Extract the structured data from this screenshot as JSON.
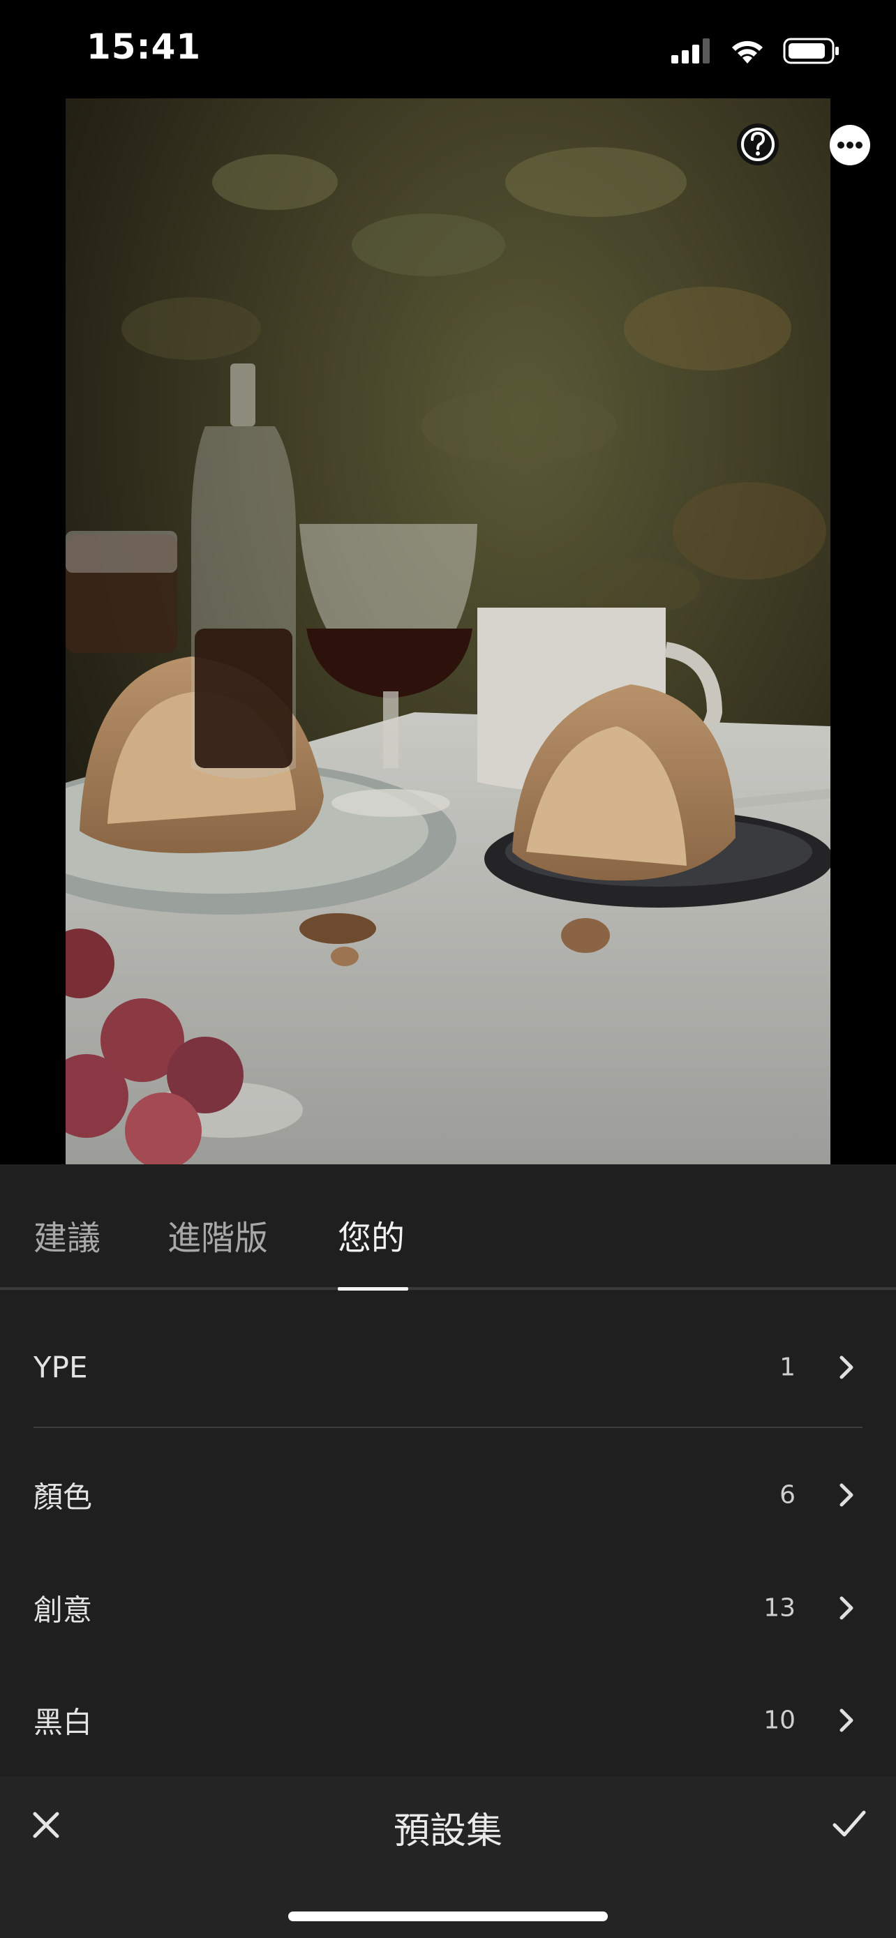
{
  "status_bar": {
    "time": "15:41",
    "battery_icon": "battery-icon",
    "wifi_icon": "wifi-icon",
    "signal_icon": "cellular-signal-icon"
  },
  "photo": {
    "help_icon": "help-icon",
    "more_icon": "more-options-icon"
  },
  "tabs": [
    {
      "label": "建議",
      "active": false
    },
    {
      "label": "進階版",
      "active": false
    },
    {
      "label": "您的",
      "active": true
    }
  ],
  "preset_groups": [
    {
      "label": "YPE",
      "count": "1"
    },
    {
      "label": "顏色",
      "count": "6"
    },
    {
      "label": "創意",
      "count": "13"
    },
    {
      "label": "黑白",
      "count": "10"
    }
  ],
  "bottom_bar": {
    "title": "預設集",
    "close_icon": "close-icon",
    "confirm_icon": "checkmark-icon"
  },
  "colors": {
    "panel_bg": "#1f1f1f",
    "bottom_bar_bg": "#242424",
    "text_primary": "#f2f2f2",
    "text_secondary": "#a8a8a8"
  }
}
